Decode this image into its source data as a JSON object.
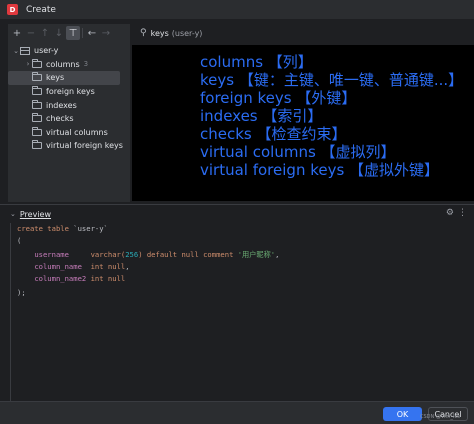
{
  "window": {
    "title": "Create"
  },
  "toolbar": {
    "add": "+",
    "remove": "−",
    "move_up": "↑",
    "move_down": "↓",
    "filter": "⊤",
    "back": "←",
    "forward": "→"
  },
  "tree": {
    "root": "user-y",
    "items": [
      {
        "label": "columns",
        "count": "3",
        "expandable": true
      },
      {
        "label": "keys",
        "selected": true
      },
      {
        "label": "foreign keys"
      },
      {
        "label": "indexes"
      },
      {
        "label": "checks"
      },
      {
        "label": "virtual columns"
      },
      {
        "label": "virtual foreign keys"
      }
    ]
  },
  "right_panel": {
    "header_label": "keys",
    "header_sub": "(user-y)"
  },
  "overlay_lines": [
    "columns 【列】",
    "keys 【键：主键、唯一键、普通键...】",
    "foreign keys 【外键】",
    "indexes 【索引】",
    "checks 【检查约束】",
    "virtual columns 【虚拟列】",
    "virtual foreign keys 【虚拟外键】"
  ],
  "preview": {
    "label": "Preview"
  },
  "code": {
    "line1_kw": "create table",
    "line1_name": "`user-y`",
    "line2": "(",
    "line3_col": "username",
    "line3_type": "varchar(",
    "line3_len": "256",
    "line3_rest": ")",
    "line3_default": "default null",
    "line3_comment_kw": "comment",
    "line3_comment": "'用户昵称'",
    "line3_end": ",",
    "line4_col": "column_name",
    "line4_type": "int null",
    "line4_end": ",",
    "line5_col": "column_name2",
    "line5_type": "int null",
    "line6": ");"
  },
  "footer": {
    "ok": "OK",
    "cancel": "Cancel",
    "watermark": "CSDN @Vim_Ice"
  },
  "colors": {
    "accent": "#3574f0",
    "overlay_text": "#2b6cf2",
    "background": "#1e1f22",
    "panel": "#2b2d30"
  }
}
